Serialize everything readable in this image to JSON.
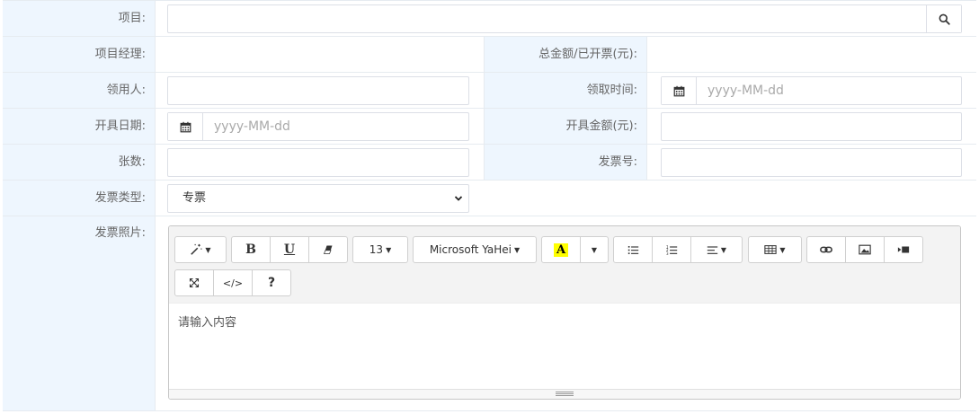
{
  "form": {
    "project": {
      "label": "项目:",
      "value": ""
    },
    "project_manager": {
      "label": "项目经理:",
      "value": ""
    },
    "total_amount": {
      "label": "总金额/已开票(元):",
      "value": ""
    },
    "receiver": {
      "label": "领用人:",
      "value": ""
    },
    "receive_time": {
      "label": "领取时间:",
      "placeholder": "yyyy-MM-dd"
    },
    "issue_date": {
      "label": "开具日期:",
      "placeholder": "yyyy-MM-dd"
    },
    "issue_amount": {
      "label": "开具金额(元):",
      "value": ""
    },
    "count": {
      "label": "张数:",
      "value": ""
    },
    "invoice_no": {
      "label": "发票号:",
      "value": ""
    },
    "invoice_type": {
      "label": "发票类型:",
      "selected": "专票"
    },
    "invoice_photo": {
      "label": "发票照片:"
    }
  },
  "editor": {
    "toolbar": {
      "font_size": "13",
      "font_name": "Microsoft YaHei",
      "color_letter": "A",
      "bold": "B",
      "underline": "U",
      "help": "?"
    },
    "placeholder": "请输入内容"
  },
  "colors": {
    "label_bg": "#eef6fe",
    "border": "#e6ebf0",
    "highlight": "#ffff00"
  }
}
